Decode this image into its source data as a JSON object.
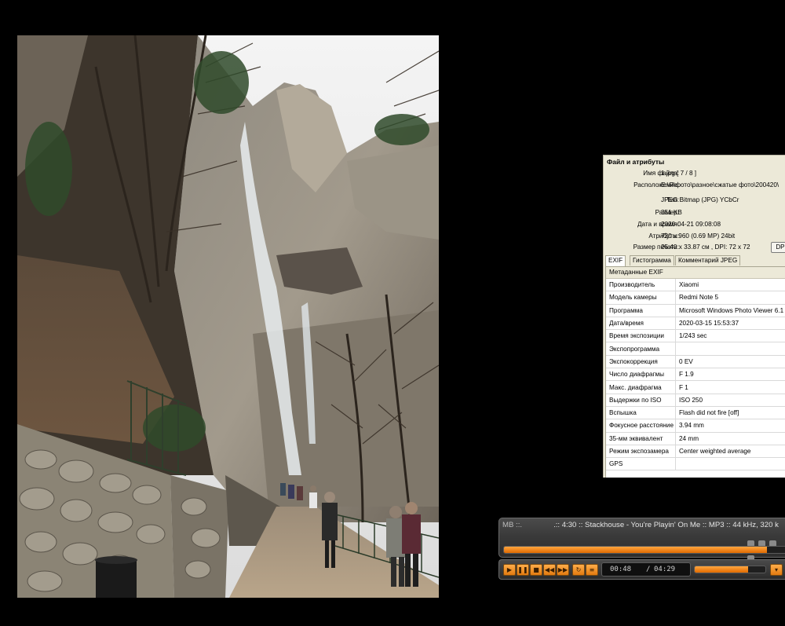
{
  "photo": {
    "description_name": "waterfall-photo"
  },
  "properties": {
    "section_title": "Файл и атрибуты",
    "fields": [
      {
        "label": "Имя файла:",
        "value": "1.jpg   [ 7 / 8 ]"
      },
      {
        "label": "Расположение:",
        "value": "E:\\Я\\фото\\разное\\сжатые фото\\200420\\"
      },
      {
        "label": "Тип:",
        "value": "JPEG Bitmap (JPG) YCbCr"
      },
      {
        "label": "Размер:",
        "value": "351 KB"
      },
      {
        "label": "Дата и время:",
        "value": "2020-04-21 09:08:08"
      },
      {
        "label": "Атрибуты:",
        "value": "720 x 960 (0.69 MP)  24bit"
      },
      {
        "label": "Размер печати:",
        "value": "25.40 x 33.87 см ,   DPI: 72 x 72"
      }
    ],
    "dpi_button": "DPI",
    "tabs": [
      "EXIF",
      "Гистограмма",
      "Комментарий JPEG"
    ],
    "exif_header": "Метаданные EXIF",
    "exif_rows": [
      {
        "key": "Производитель",
        "value": "Xiaomi"
      },
      {
        "key": "Модель камеры",
        "value": "Redmi Note 5"
      },
      {
        "key": "Программа",
        "value": "Microsoft Windows Photo Viewer 6.1"
      },
      {
        "key": "Дата/время",
        "value": "2020-03-15 15:53:37"
      },
      {
        "key": "Время экспозиции",
        "value": "1/243 sec"
      },
      {
        "key": "Экспопрограмма",
        "value": ""
      },
      {
        "key": "Экспокоррекция",
        "value": "0 EV"
      },
      {
        "key": "Число диафрагмы",
        "value": "F 1.9"
      },
      {
        "key": "Макс. диафрагма",
        "value": "F 1"
      },
      {
        "key": "Выдержки по ISO",
        "value": "ISO 250"
      },
      {
        "key": "Вспышка",
        "value": "Flash did not fire [off]"
      },
      {
        "key": "Фокусное расстояние",
        "value": "3.94 mm"
      },
      {
        "key": "35-мм эквивалент",
        "value": "24 mm"
      },
      {
        "key": "Режим экспозамера",
        "value": "Center weighted average"
      },
      {
        "key": "GPS",
        "value": ""
      }
    ]
  },
  "player": {
    "ticker_prefix": "MB ::.",
    "ticker_text": ".:: 4:30 :: Stackhouse - You're Playin' On Me :: MP3 :: 44 kHz, 320 k",
    "seek_progress": 0.93,
    "time_current": "00:48",
    "time_sep": "/",
    "time_total": "04:29",
    "volume": 0.75,
    "buttons": [
      "play",
      "pause",
      "stop",
      "prev",
      "next",
      "repeat",
      "playlist"
    ]
  },
  "colors": {
    "accent": "#f28c1c",
    "panel_bg": "#ece9d8"
  }
}
